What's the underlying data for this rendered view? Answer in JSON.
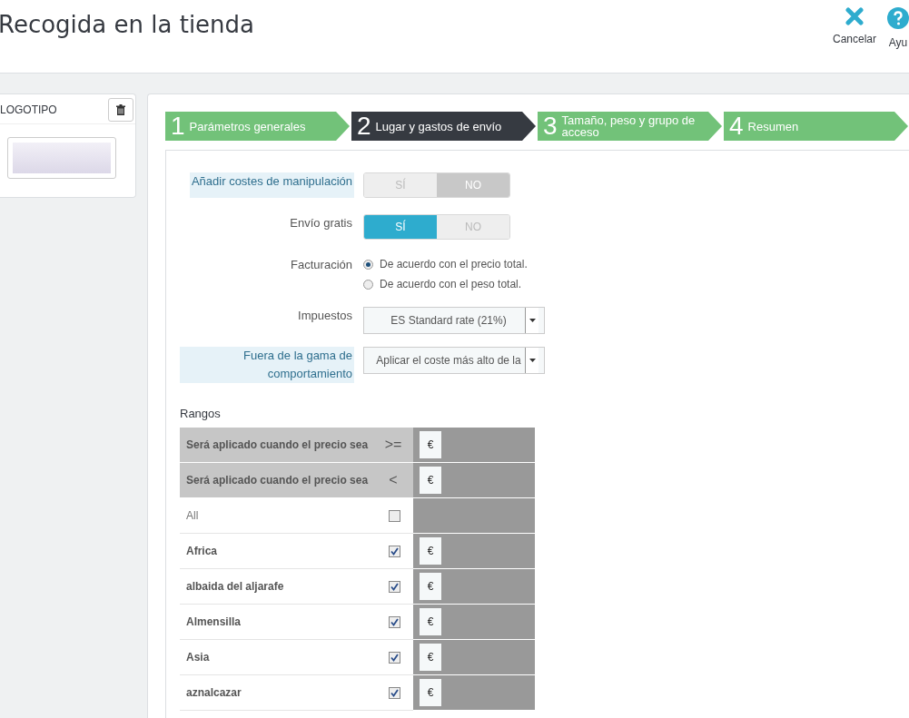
{
  "header": {
    "title": "Recogida en la tienda",
    "actions": [
      {
        "kind": "cancel",
        "label": "Cancelar"
      },
      {
        "kind": "help",
        "label": "Ayu"
      }
    ]
  },
  "logo_panel": {
    "title": "LOGOTIPO"
  },
  "steps": [
    {
      "number": "1",
      "label": "Parámetros generales",
      "selected": false
    },
    {
      "number": "2",
      "label": "Lugar y gastos de envío",
      "selected": true
    },
    {
      "number": "3",
      "label": "Tamaño, peso y grupo de acceso",
      "selected": false
    },
    {
      "number": "4",
      "label": "Resumen",
      "selected": false
    }
  ],
  "form": {
    "fields": [
      {
        "kind": "switch",
        "label": "Añadir costes de manipulación",
        "has_help": true,
        "options": [
          {
            "label": "SÍ",
            "selected": false
          },
          {
            "label": "NO",
            "selected": true
          }
        ]
      },
      {
        "kind": "switch",
        "label": "Envío gratis",
        "has_help": false,
        "options": [
          {
            "label": "SÍ",
            "selected": true
          },
          {
            "label": "NO",
            "selected": false
          }
        ]
      },
      {
        "kind": "radio",
        "label": "Facturación",
        "has_help": false,
        "options": [
          {
            "label": "De acuerdo con el precio total.",
            "selected": true
          },
          {
            "label": "De acuerdo con el peso total.",
            "selected": false
          }
        ]
      },
      {
        "kind": "select",
        "label": "Impuestos",
        "has_help": false,
        "value": "ES Standard rate (21%)"
      },
      {
        "kind": "select",
        "label": "Fuera de la gama de comportamiento",
        "has_help": true,
        "value": "Aplicar el coste más alto de la"
      }
    ]
  },
  "ranges": {
    "title": "Rangos",
    "headers": [
      {
        "label": "Será aplicado cuando el precio sea",
        "operator": ">=",
        "currency": "€"
      },
      {
        "label": "Será aplicado cuando el precio sea",
        "operator": "<",
        "currency": "€"
      }
    ],
    "rows": [
      {
        "kind": "all",
        "name": "All",
        "checked": false
      },
      {
        "kind": "zone",
        "name": "Africa",
        "checked": true,
        "currency": "€"
      },
      {
        "kind": "zone",
        "name": "albaida del aljarafe",
        "checked": true,
        "currency": "€"
      },
      {
        "kind": "zone",
        "name": "Almensilla",
        "checked": true,
        "currency": "€"
      },
      {
        "kind": "zone",
        "name": "Asia",
        "checked": true,
        "currency": "€"
      },
      {
        "kind": "zone",
        "name": "aznalcazar",
        "checked": true,
        "currency": "€"
      }
    ]
  }
}
